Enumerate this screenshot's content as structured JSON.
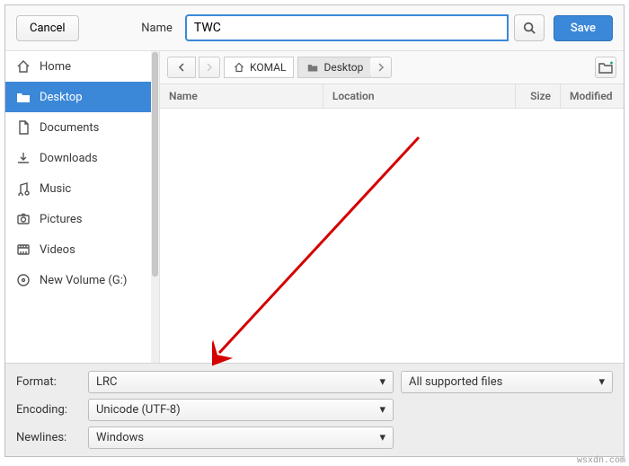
{
  "header": {
    "cancel": "Cancel",
    "name_label": "Name",
    "name_value": "TWC",
    "save": "Save"
  },
  "sidebar": {
    "items": [
      {
        "label": "Home",
        "icon": "home-icon"
      },
      {
        "label": "Desktop",
        "icon": "desktop-folder-icon",
        "selected": true
      },
      {
        "label": "Documents",
        "icon": "document-icon"
      },
      {
        "label": "Downloads",
        "icon": "download-icon"
      },
      {
        "label": "Music",
        "icon": "music-icon"
      },
      {
        "label": "Pictures",
        "icon": "camera-icon"
      },
      {
        "label": "Videos",
        "icon": "video-icon"
      },
      {
        "label": "New Volume (G:)",
        "icon": "drive-icon"
      }
    ]
  },
  "pathbar": {
    "breadcrumbs": [
      {
        "label": "KOMAL",
        "icon": "home-icon"
      },
      {
        "label": "Desktop",
        "icon": "folder-icon",
        "selected": true
      }
    ]
  },
  "columns": {
    "name": "Name",
    "location": "Location",
    "size": "Size",
    "modified": "Modified"
  },
  "footer": {
    "format_label": "Format:",
    "format_value": "LRC",
    "filter_value": "All supported files",
    "encoding_label": "Encoding:",
    "encoding_value": "Unicode (UTF-8)",
    "newlines_label": "Newlines:",
    "newlines_value": "Windows"
  },
  "watermark": "wsxdn.com"
}
